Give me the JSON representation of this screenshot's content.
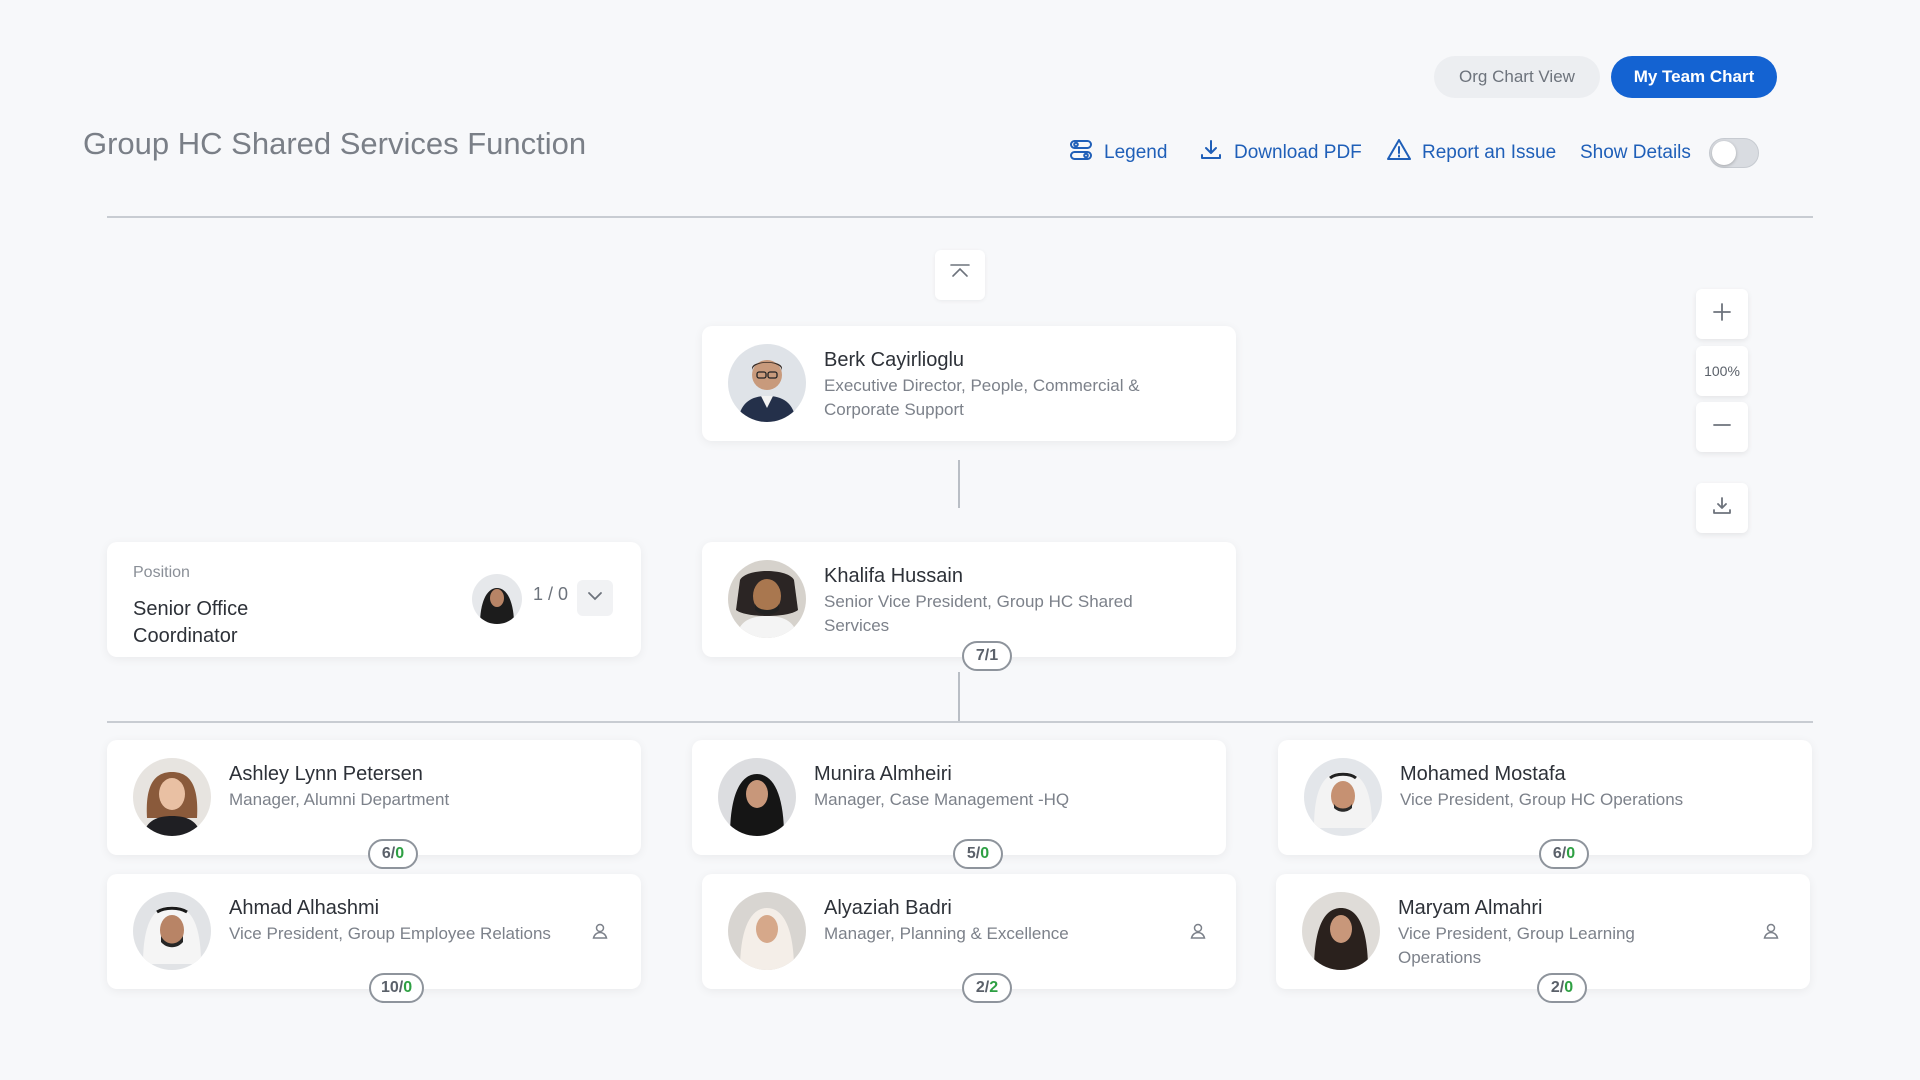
{
  "header": {
    "view_org": "Org Chart View",
    "view_team": "My Team Chart",
    "page_title": "Group HC Shared Services Function"
  },
  "toolbar": {
    "legend": "Legend",
    "download_pdf": "Download PDF",
    "report_issue": "Report an Issue",
    "show_details": "Show Details",
    "show_details_on": false
  },
  "zoom": {
    "level": "100%"
  },
  "root": {
    "name": "Berk Cayirlioglu",
    "title_l1": "Executive Director, People, Commercial &",
    "title_l2": "Corporate Support"
  },
  "manager": {
    "name": "Khalifa Hussain",
    "title_l1": "Senior Vice President, Group HC Shared",
    "title_l2": "Services",
    "count": "7/1"
  },
  "position": {
    "label": "Position",
    "name_l1": "Senior Office",
    "name_l2": "Coordinator",
    "count": "1 / 0"
  },
  "reports": [
    {
      "name": "Ashley Lynn Petersen",
      "title": "Manager, Alumni Department",
      "count_a": "6/",
      "count_b": "0"
    },
    {
      "name": "Munira Almheiri",
      "title": "Manager, Case Management -HQ",
      "count_a": "5/",
      "count_b": "0"
    },
    {
      "name": "Mohamed Mostafa",
      "title": "Vice President, Group HC Operations",
      "count_a": "6/",
      "count_b": "0"
    },
    {
      "name": "Ahmad Alhashmi",
      "title": "Vice President, Group Employee Relations",
      "count_a": "10/",
      "count_b": "0"
    },
    {
      "name": "Alyaziah Badri",
      "title": "Manager, Planning & Excellence",
      "count_a": "2/",
      "count_b": "2"
    },
    {
      "name": "Maryam Almahri",
      "title_l1": "Vice President, Group Learning",
      "title_l2": "Operations",
      "count_a": "2/",
      "count_b": "0"
    }
  ],
  "colors": {
    "accent": "#1463d2",
    "link": "#1f5fb8",
    "vacancy": "#2ea043"
  }
}
